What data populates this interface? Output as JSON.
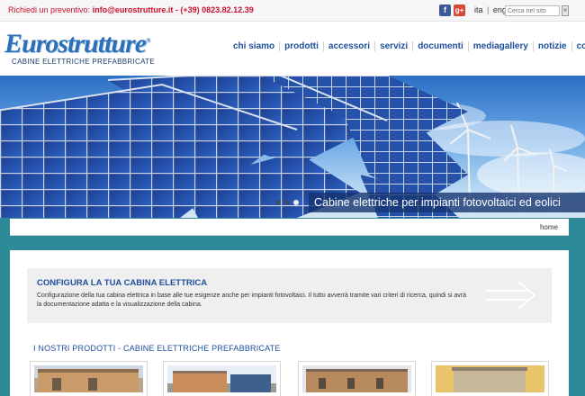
{
  "topbar": {
    "quote_prefix": "Richiedi un preventivo:",
    "email": "info@eurostrutture.it",
    "dash": "-",
    "phone": "(+39) 0823.82.12.39",
    "facebook_glyph": "f",
    "gplus_glyph": "g+",
    "lang_it": "ita",
    "lang_sep": "|",
    "lang_en": "eng",
    "search_placeholder": "Cerca nel sito",
    "search_button": "»"
  },
  "header": {
    "logo_text": "Eurostrutture",
    "logo_mark": "®",
    "logo_sub": "CABINE ELETTRICHE PREFABBRICATE"
  },
  "nav": {
    "items": [
      "chi siamo",
      "prodotti",
      "accessori",
      "servizi",
      "documenti",
      "mediagallery",
      "notizie",
      "contatti"
    ]
  },
  "banner": {
    "caption": "Cabine elettriche per impianti fotovoltaici ed eolici"
  },
  "breadcrumb": {
    "home": "home"
  },
  "config": {
    "title": "CONFIGURA LA TUA CABINA ELETTRICA",
    "text": "Configurazione della tua cabina elettrica in base alle tue esigenze anche per impianti fotovoltaici. Il tutto avverrà tramite vari criteri di ricerca, quindi si avrà la documentazione adatta e la visualizzazione della cabina."
  },
  "products": {
    "title": "I NOSTRI PRODOTTI - CABINE ELETTRICHE PREFABBRICATE"
  },
  "colors": {
    "accent": "#1d4f9c",
    "brand_red": "#c8102e",
    "page_bg": "#2d8a99"
  },
  "icons": [
    "facebook-icon",
    "google-plus-icon",
    "arrow-right-icon"
  ]
}
